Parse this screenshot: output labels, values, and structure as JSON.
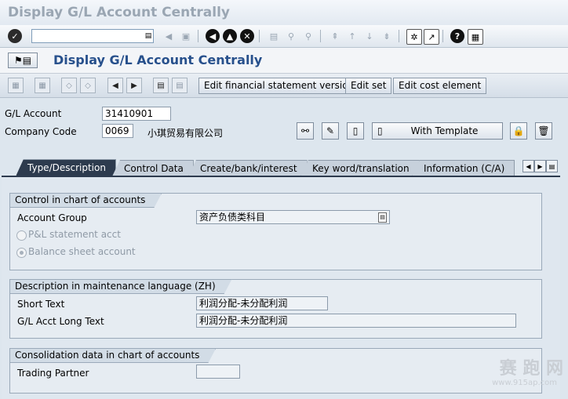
{
  "window": {
    "title": "Display G/L Account Centrally"
  },
  "std_toolbar": {
    "icons": [
      "enter-icon",
      "save-icon",
      "back-icon",
      "exit-icon",
      "cancel-icon",
      "print-icon",
      "find-icon",
      "find-next-icon",
      "first-page-icon",
      "previous-page-icon",
      "next-page-icon",
      "last-page-icon",
      "create-session-icon",
      "shortcut-icon",
      "help-icon",
      "layout-icon"
    ]
  },
  "screen": {
    "title": "Display G/L Account Centrally"
  },
  "app_toolbar": {
    "buttons": {
      "fs_version": "Edit financial statement version",
      "edit_set": "Edit set",
      "edit_cost_element": "Edit cost element"
    }
  },
  "header": {
    "gl_account_label": "G/L Account",
    "gl_account_value": "31410901",
    "company_code_label": "Company Code",
    "company_code_value": "0069",
    "company_name": "小琪贸易有限公司",
    "with_template": "With Template"
  },
  "tabs": [
    {
      "label": "Type/Description",
      "active": true
    },
    {
      "label": "Control Data",
      "active": false
    },
    {
      "label": "Create/bank/interest",
      "active": false
    },
    {
      "label": "Key word/translation",
      "active": false
    },
    {
      "label": "Information (C/A)",
      "active": false
    }
  ],
  "control_group": {
    "title": "Control in chart of accounts",
    "account_group_label": "Account Group",
    "account_group_value": "资产负债类科目",
    "pl_label": "P&L statement acct",
    "bs_label": "Balance sheet account",
    "selected": "balance_sheet"
  },
  "description_group": {
    "title": "Description in maintenance language (ZH)",
    "short_text_label": "Short Text",
    "short_text_value": "利润分配-未分配利润",
    "long_text_label": "G/L Acct Long Text",
    "long_text_value": "利润分配-未分配利润"
  },
  "consolidation_group": {
    "title": "Consolidation data in chart of accounts",
    "trading_partner_label": "Trading Partner",
    "trading_partner_value": ""
  },
  "watermark": {
    "text": "赛 跑 网",
    "url": "www.915ap.com"
  }
}
